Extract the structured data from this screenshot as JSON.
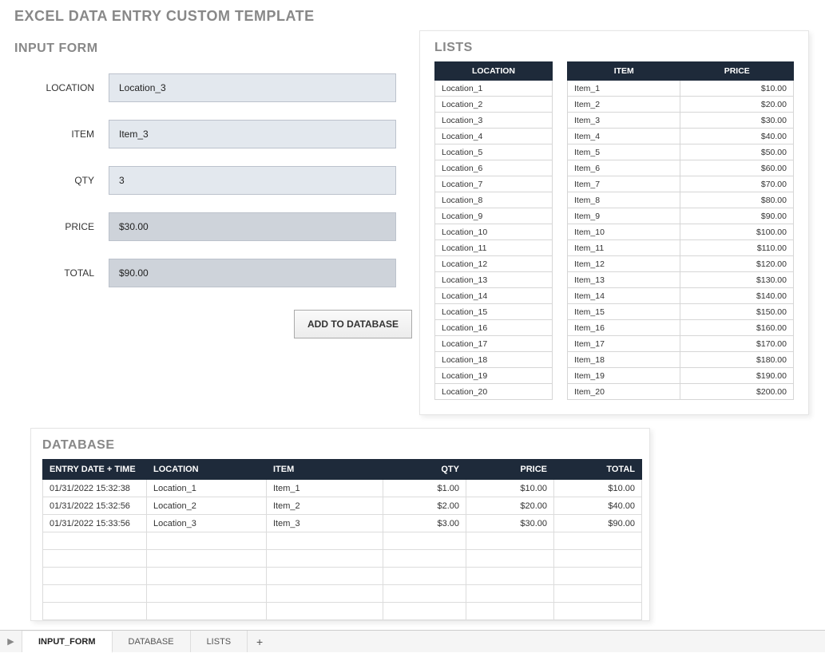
{
  "main_title": "EXCEL DATA ENTRY CUSTOM TEMPLATE",
  "input_form": {
    "title": "INPUT FORM",
    "labels": {
      "location": "LOCATION",
      "item": "ITEM",
      "qty": "QTY",
      "price": "PRICE",
      "total": "TOTAL"
    },
    "values": {
      "location": "Location_3",
      "item": "Item_3",
      "qty": "3",
      "price": "$30.00",
      "total": "$90.00"
    },
    "add_button": "ADD TO DATABASE"
  },
  "lists": {
    "title": "LISTS",
    "location_header": "LOCATION",
    "item_header": "ITEM",
    "price_header": "PRICE",
    "locations": [
      "Location_1",
      "Location_2",
      "Location_3",
      "Location_4",
      "Location_5",
      "Location_6",
      "Location_7",
      "Location_8",
      "Location_9",
      "Location_10",
      "Location_11",
      "Location_12",
      "Location_13",
      "Location_14",
      "Location_15",
      "Location_16",
      "Location_17",
      "Location_18",
      "Location_19",
      "Location_20"
    ],
    "items": [
      {
        "name": "Item_1",
        "price": "$10.00"
      },
      {
        "name": "Item_2",
        "price": "$20.00"
      },
      {
        "name": "Item_3",
        "price": "$30.00"
      },
      {
        "name": "Item_4",
        "price": "$40.00"
      },
      {
        "name": "Item_5",
        "price": "$50.00"
      },
      {
        "name": "Item_6",
        "price": "$60.00"
      },
      {
        "name": "Item_7",
        "price": "$70.00"
      },
      {
        "name": "Item_8",
        "price": "$80.00"
      },
      {
        "name": "Item_9",
        "price": "$90.00"
      },
      {
        "name": "Item_10",
        "price": "$100.00"
      },
      {
        "name": "Item_11",
        "price": "$110.00"
      },
      {
        "name": "Item_12",
        "price": "$120.00"
      },
      {
        "name": "Item_13",
        "price": "$130.00"
      },
      {
        "name": "Item_14",
        "price": "$140.00"
      },
      {
        "name": "Item_15",
        "price": "$150.00"
      },
      {
        "name": "Item_16",
        "price": "$160.00"
      },
      {
        "name": "Item_17",
        "price": "$170.00"
      },
      {
        "name": "Item_18",
        "price": "$180.00"
      },
      {
        "name": "Item_19",
        "price": "$190.00"
      },
      {
        "name": "Item_20",
        "price": "$200.00"
      }
    ]
  },
  "database": {
    "title": "DATABASE",
    "headers": {
      "entry": "ENTRY DATE + TIME",
      "location": "LOCATION",
      "item": "ITEM",
      "qty": "QTY",
      "price": "PRICE",
      "total": "TOTAL"
    },
    "rows": [
      {
        "entry": "01/31/2022 15:32:38",
        "location": "Location_1",
        "item": "Item_1",
        "qty": "$1.00",
        "price": "$10.00",
        "total": "$10.00"
      },
      {
        "entry": "01/31/2022 15:32:56",
        "location": "Location_2",
        "item": "Item_2",
        "qty": "$2.00",
        "price": "$20.00",
        "total": "$40.00"
      },
      {
        "entry": "01/31/2022 15:33:56",
        "location": "Location_3",
        "item": "Item_3",
        "qty": "$3.00",
        "price": "$30.00",
        "total": "$90.00"
      }
    ],
    "empty_rows": 5
  },
  "sheet_tabs": [
    "INPUT_FORM",
    "DATABASE",
    "LISTS"
  ],
  "active_tab": 0
}
